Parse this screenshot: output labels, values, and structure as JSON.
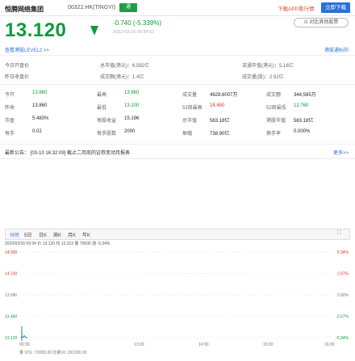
{
  "header": {
    "name": "恒腾网络集团",
    "code": "00322.HK(TINGYI)",
    "badge": "通",
    "app_text": "下载APP看行情",
    "button": "立即下载"
  },
  "quote": {
    "price": "13.120",
    "change": "-0.740 (-5.339%)",
    "timestamp": "2022-03-16 09:34:52",
    "compare_button": "⊙ 对比其他股票"
  },
  "info_links": {
    "level2": "查看港股LEVEL2 >>",
    "right_top": "港股通标的",
    "right_sub": "买卖盘"
  },
  "summary_rows": [
    {
      "left_label": "今日开盘价",
      "left_value": "",
      "mid_label": "总市值(港元)",
      "mid_value": "6,582亿",
      "right_label": "流通市值(港元)",
      "right_value": "5.16亿"
    },
    {
      "left_label": "昨日收盘价",
      "left_value": "",
      "mid_label": "成交额(港元)",
      "mid_value": "1.4亿",
      "right_label": "成交量(股)",
      "right_value": "2.92亿"
    }
  ],
  "stats": [
    [
      {
        "label": "今开",
        "value": "13.860",
        "cls": "green"
      },
      {
        "label": "最高",
        "value": "13.860",
        "cls": "green"
      },
      {
        "label": "成交量",
        "value": "4628.6007万",
        "cls": "dark"
      },
      {
        "label": "成交额",
        "value": "344,565万",
        "cls": "dark"
      }
    ],
    [
      {
        "label": "昨收",
        "value": "13.860",
        "cls": "dark"
      },
      {
        "label": "最低",
        "value": "13.100",
        "cls": "green"
      },
      {
        "label": "52周最高",
        "value": "18.480",
        "cls": "red"
      },
      {
        "label": "52周最低",
        "value": "12.760",
        "cls": "green"
      }
    ],
    [
      {
        "label": "市盈",
        "value": "5.483%",
        "cls": "dark"
      },
      {
        "label": "每股收益",
        "value": "15.196",
        "cls": "dark"
      },
      {
        "label": "总市值",
        "value": "563.18亿",
        "cls": "dark"
      },
      {
        "label": "港股市值",
        "value": "563.18亿",
        "cls": "dark"
      }
    ],
    [
      {
        "label": "每手",
        "value": "0.02",
        "cls": "dark"
      },
      {
        "label": "每手股数",
        "value": "2000",
        "cls": "dark"
      },
      {
        "label": "振幅",
        "value": "738.90亿",
        "cls": "dark"
      },
      {
        "label": "换手率",
        "value": "0.000%",
        "cls": "dark"
      }
    ]
  ],
  "news": {
    "text": "最新公告： [03-10 16:32:09] 截止二月底的证券变动月报表",
    "more": "更多>>"
  },
  "chart_tabs": [
    "分时",
    "5日",
    "日K",
    "周K",
    "月K",
    "年K"
  ],
  "chart_info": "2022/03/16 09:34  价 13.120  均 13.313  量 70000  涨 -5.34%",
  "chart_data": {
    "type": "line",
    "y_left_labels": [
      "14.900",
      "14.230",
      "13.680",
      "13.460",
      "13.120"
    ],
    "y_right_labels": [
      "5.34%",
      "2.67%",
      "0.00%",
      "-2.67%",
      "-5.34%"
    ],
    "x_labels": [
      "09:30",
      "13:00",
      "14:00",
      "15:00",
      "16:00"
    ],
    "footer": "量 VOL: 70000.00  均量10: 292200.00",
    "price_points": [
      13.14,
      13.12,
      13.16,
      13.1,
      13.12
    ],
    "ylim": [
      13.12,
      14.9
    ]
  }
}
